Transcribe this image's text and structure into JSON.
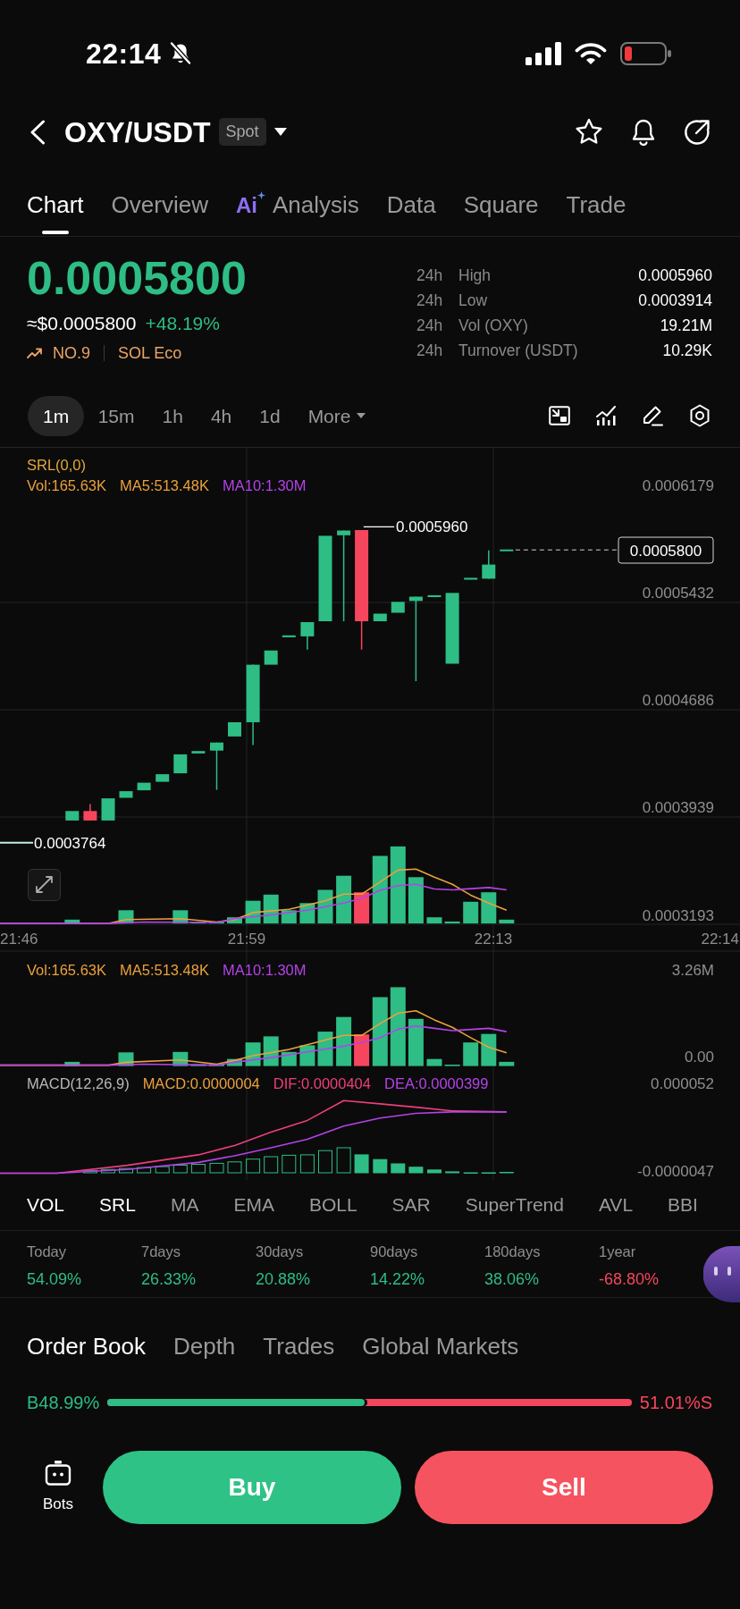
{
  "status_bar": {
    "time": "22:14"
  },
  "header": {
    "pair": "OXY/USDT",
    "market": "Spot"
  },
  "tabs": [
    {
      "label": "Chart",
      "selected": true
    },
    {
      "label": "Overview",
      "selected": false
    },
    {
      "label": "Analysis",
      "selected": false,
      "badge": "Ai"
    },
    {
      "label": "Data",
      "selected": false
    },
    {
      "label": "Square",
      "selected": false
    },
    {
      "label": "Trade",
      "selected": false
    }
  ],
  "price": {
    "last": "0.0005800",
    "fiat": "≈$0.0005800",
    "change": "+48.19%",
    "rank": "NO.9",
    "tag": "SOL Eco"
  },
  "stats": [
    {
      "period": "24h",
      "label": "High",
      "value": "0.0005960"
    },
    {
      "period": "24h",
      "label": "Low",
      "value": "0.0003914"
    },
    {
      "period": "24h",
      "label": "Vol (OXY)",
      "value": "19.21M"
    },
    {
      "period": "24h",
      "label": "Turnover (USDT)",
      "value": "10.29K"
    }
  ],
  "timeframes": [
    {
      "label": "1m",
      "selected": true
    },
    {
      "label": "15m",
      "selected": false
    },
    {
      "label": "1h",
      "selected": false
    },
    {
      "label": "4h",
      "selected": false
    },
    {
      "label": "1d",
      "selected": false
    }
  ],
  "more": "More",
  "main_chart": {
    "indicator": "SRL(0,0)",
    "legend": [
      {
        "text": "Vol:165.63K",
        "color": "#eba13c"
      },
      {
        "text": "MA5:513.48K",
        "color": "#eba13c"
      },
      {
        "text": "MA10:1.30M",
        "color": "#b443e8"
      }
    ],
    "y_labels": [
      "0.0006179",
      "0.0005432",
      "0.0004686",
      "0.0003939",
      "0.0003193"
    ],
    "high_marker": "0.0005960",
    "low_marker": "0.0003764",
    "last_price": "0.0005800",
    "time_labels": [
      "21:46",
      "21:59",
      "22:13",
      "22:14"
    ]
  },
  "volume_pane": {
    "legend": [
      {
        "text": "Vol:165.63K",
        "color": "#eba13c"
      },
      {
        "text": "MA5:513.48K",
        "color": "#eba13c"
      },
      {
        "text": "MA10:1.30M",
        "color": "#b443e8"
      }
    ],
    "y_labels": [
      "3.26M",
      "0.00"
    ]
  },
  "macd_pane": {
    "legend": [
      {
        "text": "MACD(12,26,9)",
        "color": "#b9b9b9"
      },
      {
        "text": "MACD:0.0000004",
        "color": "#eba13c"
      },
      {
        "text": "DIF:0.0000404",
        "color": "#ec3f7d"
      },
      {
        "text": "DEA:0.0000399",
        "color": "#b443e8"
      }
    ],
    "y_labels": [
      "0.000052",
      "-0.0000047"
    ]
  },
  "indicators": [
    {
      "label": "VOL",
      "selected": true
    },
    {
      "label": "SRL",
      "selected": true
    },
    {
      "label": "MA",
      "selected": false
    },
    {
      "label": "EMA",
      "selected": false
    },
    {
      "label": "BOLL",
      "selected": false
    },
    {
      "label": "SAR",
      "selected": false
    },
    {
      "label": "SuperTrend",
      "selected": false
    },
    {
      "label": "AVL",
      "selected": false
    },
    {
      "label": "BBI",
      "selected": false
    }
  ],
  "returns": [
    {
      "period": "Today",
      "value": "54.09%",
      "negative": false
    },
    {
      "period": "7days",
      "value": "26.33%",
      "negative": false
    },
    {
      "period": "30days",
      "value": "20.88%",
      "negative": false
    },
    {
      "period": "90days",
      "value": "14.22%",
      "negative": false
    },
    {
      "period": "180days",
      "value": "38.06%",
      "negative": false
    },
    {
      "period": "1year",
      "value": "-68.80%",
      "negative": true
    }
  ],
  "book_tabs": [
    {
      "label": "Order Book",
      "selected": true
    },
    {
      "label": "Depth",
      "selected": false
    },
    {
      "label": "Trades",
      "selected": false
    },
    {
      "label": "Global Markets",
      "selected": false
    }
  ],
  "buy_sell_ratio": {
    "buy_text": "B48.99%",
    "sell_text": "51.01%S",
    "level": 0.4899
  },
  "bottom_bar": {
    "bots": "Bots",
    "buy": "Buy",
    "sell": "Sell"
  }
}
